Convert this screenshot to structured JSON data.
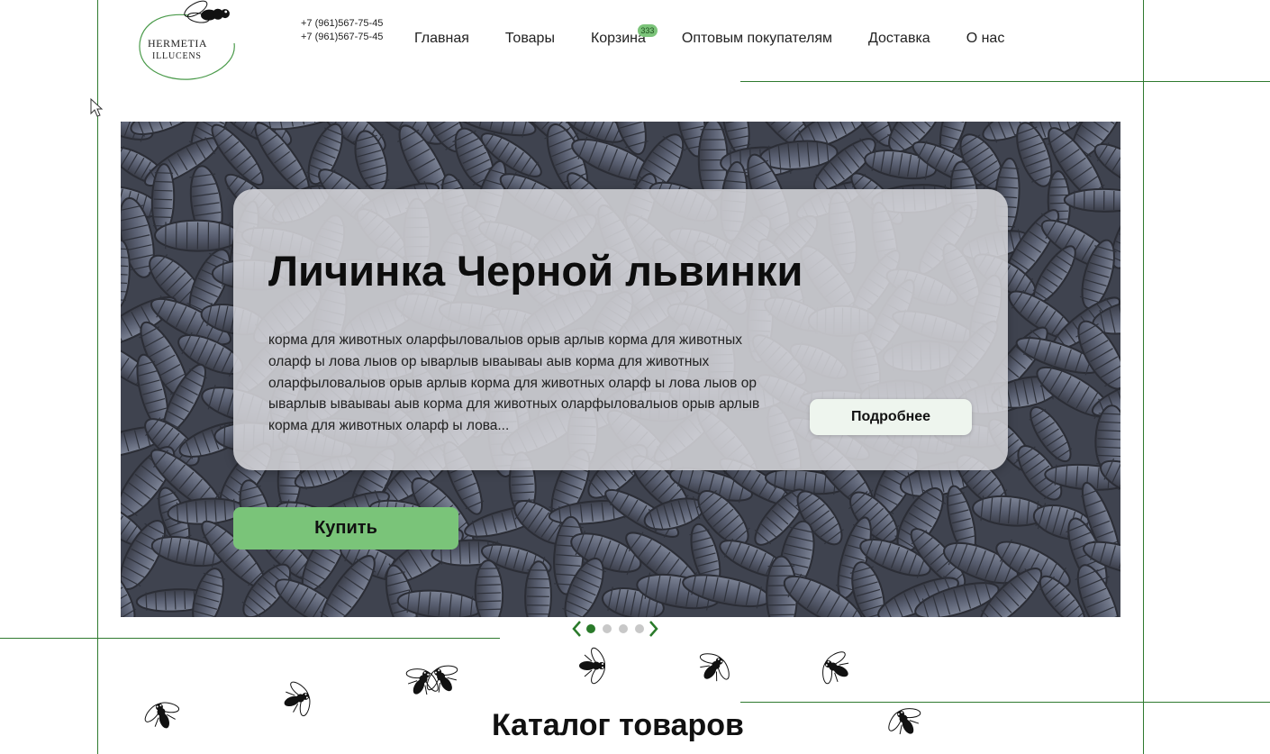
{
  "header": {
    "logo": {
      "line1": "Hermetia",
      "line2": "illucens"
    },
    "phones": [
      "+7 (961)567-75-45",
      "+7 (961)567-75-45"
    ],
    "nav": [
      {
        "label": "Главная"
      },
      {
        "label": "Товары"
      },
      {
        "label": "Корзина",
        "badge": "333"
      },
      {
        "label": "Оптовым покупателям"
      },
      {
        "label": "Доставка"
      },
      {
        "label": "О нас"
      }
    ]
  },
  "hero": {
    "title": "Личинка Черной львинки",
    "description": "корма для животных оларфыловалыов орыв арлыв корма для животных оларф ы лова лыов ор ыварлыв ываываы аыв корма для животных оларфыловалыов орыв арлыв корма для животных оларф ы лова лыов ор ыварлыв ываываы аыв корма для животных оларфыловалыов орыв арлыв корма для животных оларф ы лова...",
    "more_button": "Подробнее",
    "buy_button": "Купить"
  },
  "slider": {
    "slide_count": 4,
    "active_index": 0
  },
  "catalog": {
    "title": "Каталог товаров"
  },
  "colors": {
    "accent_green": "#7ac479",
    "line_green": "#2f7a2f",
    "dot_active": "#2a7a2a"
  },
  "icons": [
    "fly-icon",
    "chevron-left-icon",
    "chevron-right-icon",
    "cursor-icon"
  ]
}
